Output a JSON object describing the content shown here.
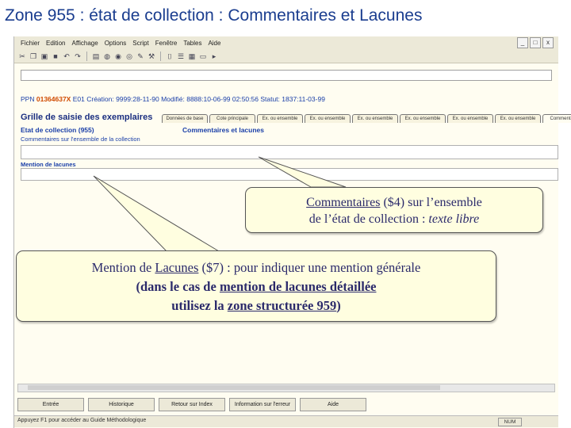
{
  "slide": {
    "title": "Zone 955 : état de collection : Commentaires et Lacunes"
  },
  "menu": {
    "items": [
      "Fichier",
      "Edition",
      "Affichage",
      "Options",
      "Script",
      "Fenêtre",
      "Tables",
      "Aide"
    ]
  },
  "window_controls": [
    "_",
    "□",
    "x"
  ],
  "toolbar": {
    "icons": [
      "scissors-icon",
      "copy-icon",
      "paste-icon",
      "save-icon",
      "undo-icon",
      "redo-icon",
      "print-icon",
      "globe-icon",
      "forward-icon",
      "back-icon",
      "edit-icon",
      "tools-icon",
      "bracket-icon",
      "list-icon",
      "image-icon",
      "document-icon",
      "arrow-icon"
    ]
  },
  "record": {
    "ppn_label": "PPN",
    "ppn_number": "01364637X",
    "ppn_rest": "E01 Création: 9999:28-11-90 Modifié: 8888:10-06-99 02:50:56 Statut: 1837:11-03-99"
  },
  "grille": {
    "title": "Grille de saisie des exemplaires",
    "tabs": [
      "Données de base",
      "Cote principale",
      "Ex. ou ensemble",
      "Ex. ou ensemble",
      "Ex. ou ensemble",
      "Ex. ou ensemble",
      "Ex. ou ensemble",
      "Ex. ou ensemble",
      "Commentaires"
    ]
  },
  "section": {
    "etat": "Etat de collection (955)",
    "title": "Commentaires et lacunes",
    "commentaires_label": "Commentaires sur l'ensemble de la collection",
    "mention_label": "Mention de lacunes"
  },
  "buttons": [
    "Entrée",
    "Historique",
    "Retour sur Index",
    "Information sur l'erreur",
    "Aide"
  ],
  "statusbar": {
    "text": "Appuyez F1 pour accéder au Guide Méthodologique",
    "num": "NUM"
  },
  "callout1": {
    "word1": "Commentaires",
    "text1": " ($4) sur l’ensemble",
    "text2": "de l’état de collection : ",
    "text3": "texte libre"
  },
  "callout2": {
    "text1": "Mention de ",
    "word1": "Lacunes",
    "text2": " ($7) : pour indiquer une mention générale",
    "text3": "(dans le cas de ",
    "word2": "mention de lacunes détaillée",
    "text4": "utilisez la ",
    "word3": "zone structurée 959",
    "text5": ")"
  },
  "colors": {
    "title": "#1a3d8f",
    "label_blue": "#1a3fa8",
    "ppn_orange": "#d04a00",
    "callout_bg": "#fffee0",
    "app_bg": "#fffdf1"
  }
}
